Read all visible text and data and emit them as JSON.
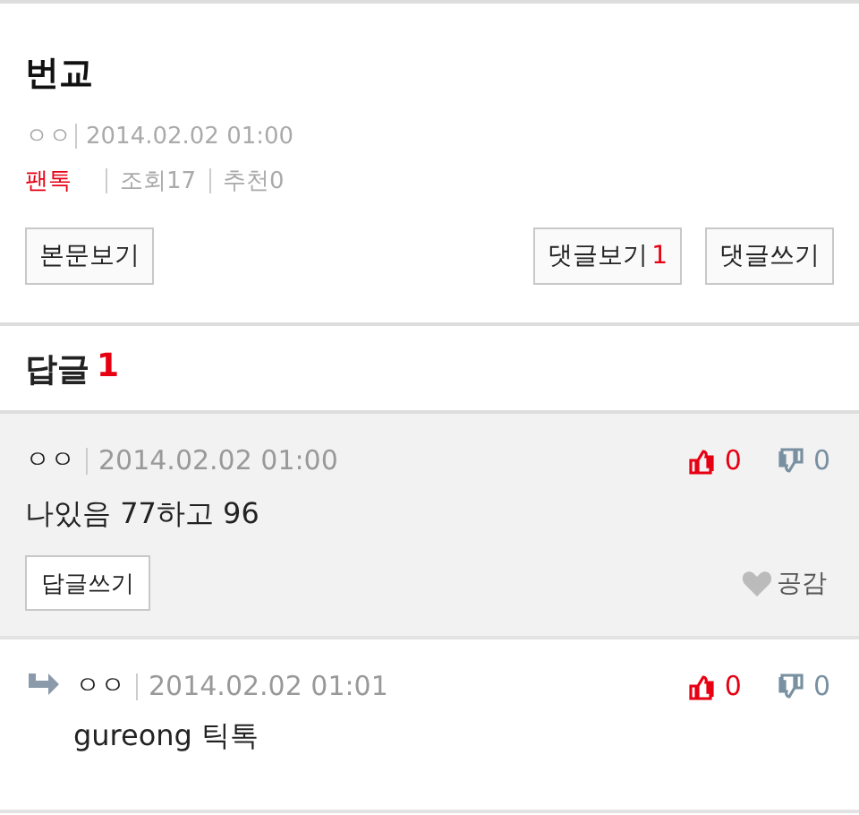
{
  "post": {
    "title": "번교",
    "author": "ㅇㅇ",
    "date": "2014.02.02 01:00",
    "category": "팬톡",
    "views": "조회17",
    "recommends": "추천0",
    "buttons": [
      {
        "kind": "view",
        "label": "본문보기"
      },
      {
        "kind": "comments",
        "label": "댓글보기",
        "count": "1"
      },
      {
        "kind": "write",
        "label": "댓글쓰기"
      }
    ]
  },
  "replies": {
    "heading": "답글",
    "count": "1",
    "items": [
      {
        "kind": "comment",
        "author": "ㅇㅇ",
        "date": "2014.02.02 01:00",
        "likes": "0",
        "dislikes": "0",
        "text": "나있음 77하고 96",
        "reply_button": "답글쓰기",
        "empathy": "공감"
      },
      {
        "kind": "reply",
        "author": "ㅇㅇ",
        "date": "2014.02.02 01:01",
        "likes": "0",
        "dislikes": "0",
        "text": "gureong 틱톡"
      }
    ]
  }
}
